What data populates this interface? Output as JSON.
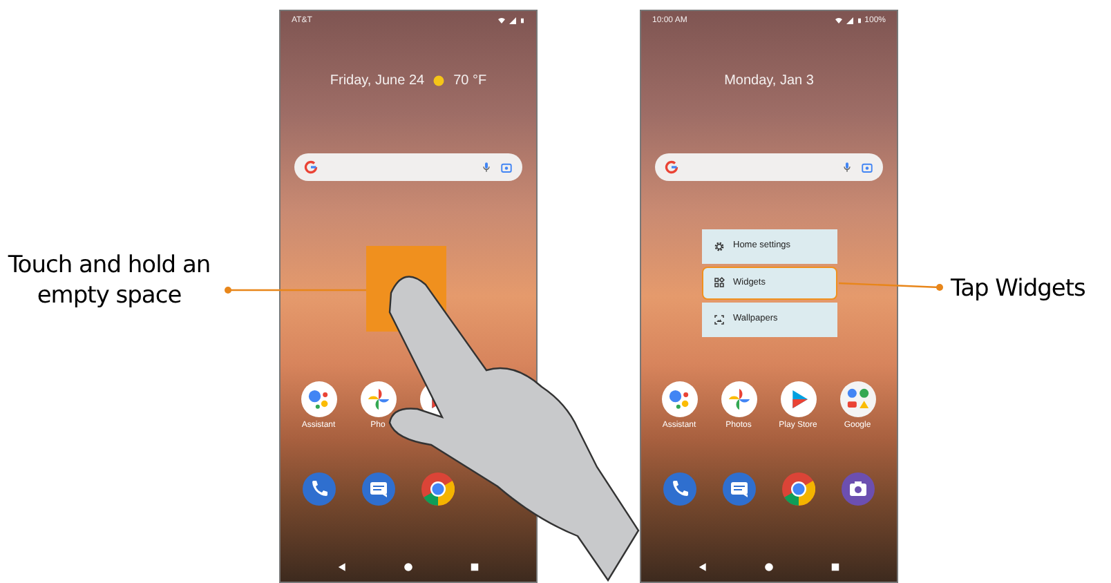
{
  "callouts": [
    {
      "text": "Touch and hold an empty space"
    },
    {
      "text": "Tap Widgets"
    }
  ],
  "phones": [
    {
      "status": {
        "left": "AT&T"
      },
      "date": "Friday, June 24",
      "weather": "70 °F",
      "touch_target": true,
      "hand": true,
      "apps": [
        {
          "kind": "assistant",
          "label": "Assistant"
        },
        {
          "kind": "photos",
          "label": "Pho"
        },
        {
          "kind": "play"
        }
      ],
      "dock": [
        {
          "kind": "phone"
        },
        {
          "kind": "messages"
        },
        {
          "kind": "chrome"
        }
      ]
    },
    {
      "status": {
        "left": "10:00 AM",
        "battery": "100%"
      },
      "date": "Monday, Jan 3",
      "touch_target": false,
      "hand": false,
      "menu": [
        {
          "kind": "settings",
          "label": "Home settings",
          "selected": false
        },
        {
          "kind": "widgets",
          "label": "Widgets",
          "selected": true
        },
        {
          "kind": "wallpapers",
          "label": "Wallpapers",
          "selected": false
        }
      ],
      "apps": [
        {
          "kind": "assistant",
          "label": "Assistant"
        },
        {
          "kind": "photos",
          "label": "Photos"
        },
        {
          "kind": "play",
          "label": "Play Store"
        },
        {
          "kind": "google",
          "label": "Google"
        }
      ],
      "dock": [
        {
          "kind": "phone"
        },
        {
          "kind": "messages"
        },
        {
          "kind": "chrome"
        },
        {
          "kind": "camera"
        }
      ]
    }
  ]
}
